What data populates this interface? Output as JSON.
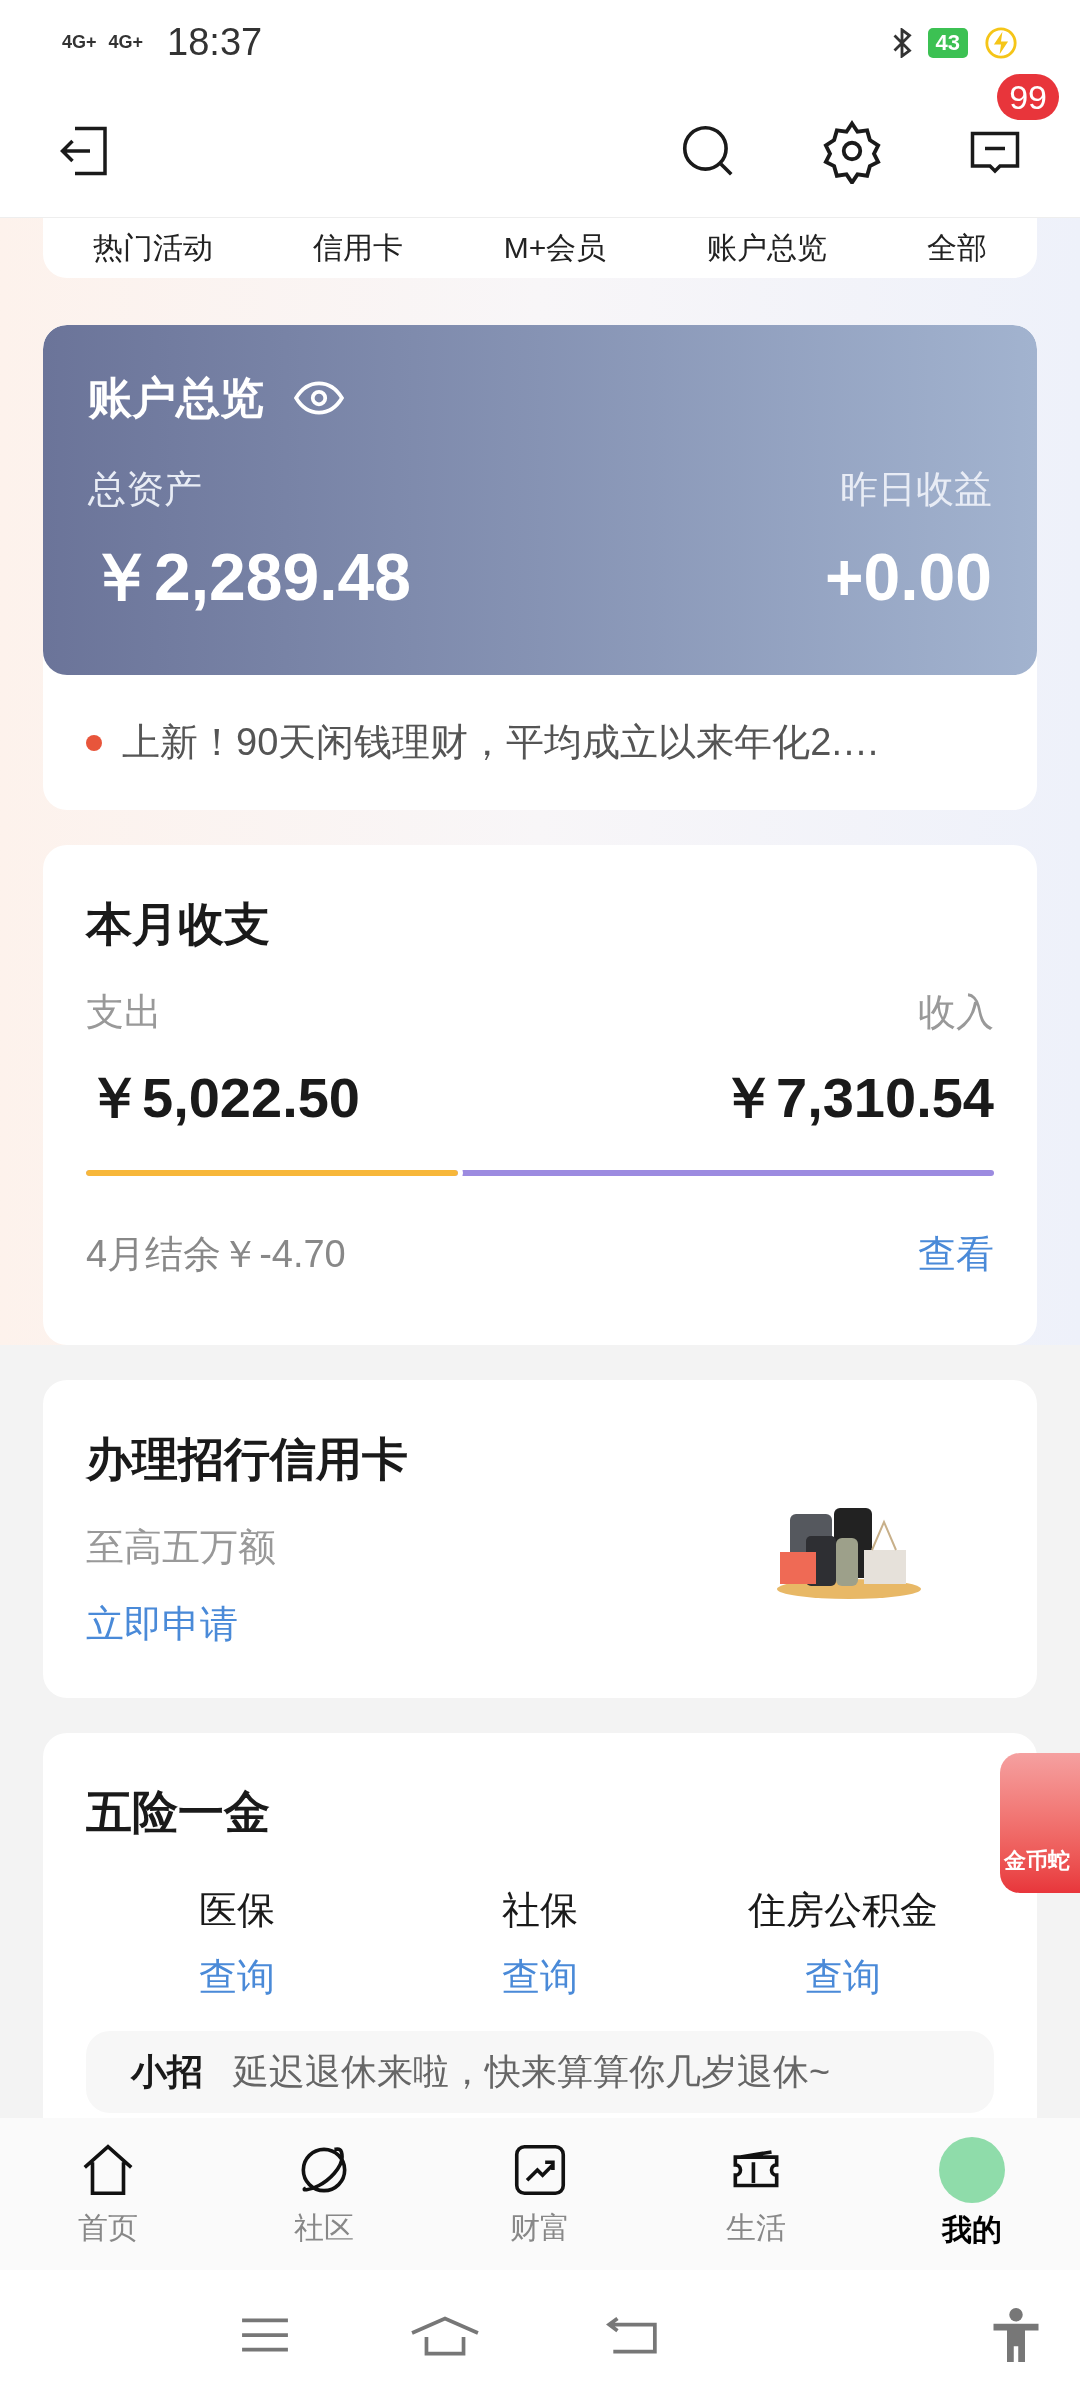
{
  "status_bar": {
    "network_1": "4G+",
    "network_2": "4G+",
    "time": "18:37",
    "battery": "43"
  },
  "header": {
    "message_badge": "99"
  },
  "quick_links": [
    "热门活动",
    "信用卡",
    "M+会员",
    "账户总览",
    "全部"
  ],
  "account_overview": {
    "title": "账户总览",
    "total_assets_label": "总资产",
    "total_assets": "￥2,289.48",
    "yesterday_label": "昨日收益",
    "yesterday_value": "+0.00",
    "notice": "上新！90天闲钱理财，平均成立以来年化2.…"
  },
  "monthly": {
    "title": "本月收支",
    "expense_label": "支出",
    "income_label": "收入",
    "expense": "￥5,022.50",
    "income": "￥7,310.54",
    "expense_share": {
      "level": 0.41
    },
    "balance": "4月结余￥-4.70",
    "link": "查看"
  },
  "credit_card": {
    "title": "办理招行信用卡",
    "subtitle": "至高五万额",
    "link": "立即申请"
  },
  "insurance": {
    "title": "五险一金",
    "items": [
      {
        "label": "医保",
        "link": "查询"
      },
      {
        "label": "社保",
        "link": "查询"
      },
      {
        "label": "住房公积金",
        "link": "查询"
      }
    ],
    "tip_tag": "小招",
    "tip": "延迟退休来啦，快来算算你几岁退休~"
  },
  "floating_badge": "金币蛇",
  "bottom_nav": [
    {
      "label": "首页",
      "kind": "home",
      "selected": false
    },
    {
      "label": "社区",
      "kind": "planet",
      "selected": false
    },
    {
      "label": "财富",
      "kind": "chart",
      "selected": false
    },
    {
      "label": "生活",
      "kind": "ticket",
      "selected": false
    },
    {
      "label": "我的",
      "kind": "avatar",
      "selected": true
    }
  ]
}
